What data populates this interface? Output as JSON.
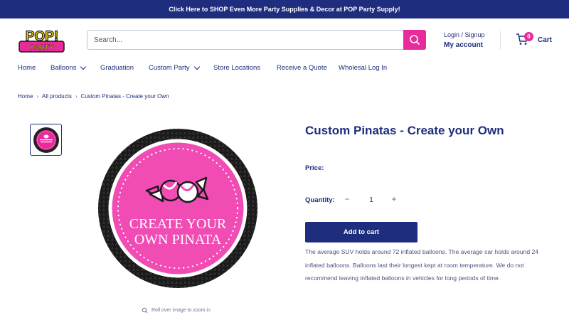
{
  "announcement": "Click Here to SHOP Even More Party Supplies & Decor at POP Party Supply!",
  "logo": {
    "top": "POP!",
    "bottom": "PARTY"
  },
  "search": {
    "placeholder": "Search..."
  },
  "account": {
    "login": "Login / Signup",
    "my_account": "My account"
  },
  "cart": {
    "label": "Cart",
    "count": "0"
  },
  "nav": [
    {
      "label": "Home",
      "has_dropdown": false
    },
    {
      "label": "Balloons",
      "has_dropdown": true
    },
    {
      "label": "Graduation",
      "has_dropdown": false
    },
    {
      "label": "Custom Party",
      "has_dropdown": true
    },
    {
      "label": "Store Locations",
      "has_dropdown": false
    },
    {
      "label": "Receive a Quote",
      "has_dropdown": false
    },
    {
      "label": "Wholesal Log In",
      "has_dropdown": false
    }
  ],
  "breadcrumb": [
    "Home",
    "All products",
    "Custom Pinatas - Create your Own"
  ],
  "product": {
    "title": "Custom Pinatas - Create your Own",
    "image_text": [
      "CREATE YOUR",
      "OWN PINATA"
    ],
    "price_label": "Price:",
    "quantity_label": "Quantity:",
    "quantity": "1",
    "minus": "−",
    "plus": "+",
    "add_to_cart": "Add to cart",
    "description": "The average SUV holds around 72 inflated balloons. The average car holds around 24 inflated balloons. Balloons last their longest kept at room temperature. We do not recommend leaving inflated balloons in vehicles for long periods of time.",
    "zoom_hint": "Roll over image to zoom in"
  },
  "colors": {
    "navy": "#1e2d7d",
    "pink": "#e82a9b",
    "black": "#1a1a1a"
  }
}
